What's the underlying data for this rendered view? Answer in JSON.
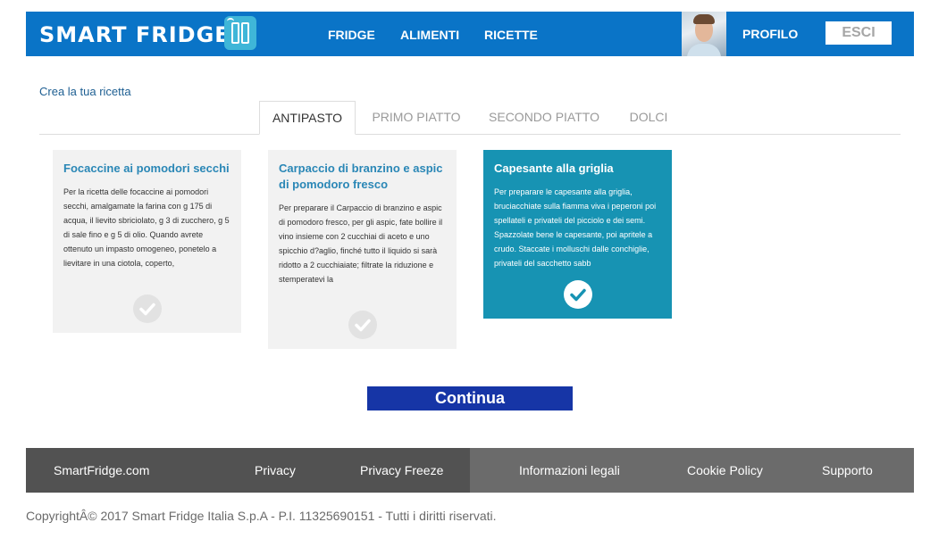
{
  "header": {
    "logo_text": "SMART FRIDGE",
    "logo_icon": "fridge-icon",
    "nav": [
      "FRIDGE",
      "ALIMENTI",
      "RICETTE"
    ],
    "profile_label": "PROFILO",
    "logout_label": "ESCI",
    "brand_color": "#0a74c7"
  },
  "page": {
    "title": "Crea la tua ricetta"
  },
  "tabs": [
    "ANTIPASTO",
    "PRIMO PIATTO",
    "SECONDO PIATTO",
    "DOLCI"
  ],
  "active_tab": "ANTIPASTO",
  "recipes": [
    {
      "title": "Focaccine ai pomodori secchi",
      "body": "Per la ricetta delle focaccine ai pomodori secchi, amalgamate la farina con g 175 di acqua, il lievito sbriciolato, g 3 di zucchero, g 5 di sale fino e g 5 di olio. Quando avrete ottenuto un impasto omogeneo, ponetelo a lievitare in una ciotola, coperto,",
      "selected": false
    },
    {
      "title": "Carpaccio di branzino e aspic di pomodoro fresco",
      "body": "Per preparare il Carpaccio di branzino e aspic di pomodoro fresco, per gli aspic, fate bollire il vino insieme con 2 cucchiai di aceto e uno spicchio d?aglio, finché tutto il liquido si sarà ridotto a 2 cucchiaiate; filtrate la riduzione e stemperatevi la",
      "selected": false
    },
    {
      "title": "Capesante alla griglia",
      "body": "Per preparare le capesante alla griglia, bruciacchiate sulla fiamma viva i peperoni poi spellateli e privateli del picciolo e dei semi. Spazzolate bene le capesante, poi apritele a crudo. Staccate i molluschi dalle conchiglie, privateli del sacchetto sabb",
      "selected": true
    }
  ],
  "continue_label": "Continua",
  "footer": {
    "links": [
      "SmartFridge.com",
      "Privacy",
      "Privacy Freeze",
      "Informazioni legali",
      "Cookie Policy",
      "Supporto"
    ],
    "copyright": "CopyrightÂ© 2017 Smart Fridge Italia S.p.A - P.I. 11325690151 - Tutti i diritti riservati."
  }
}
